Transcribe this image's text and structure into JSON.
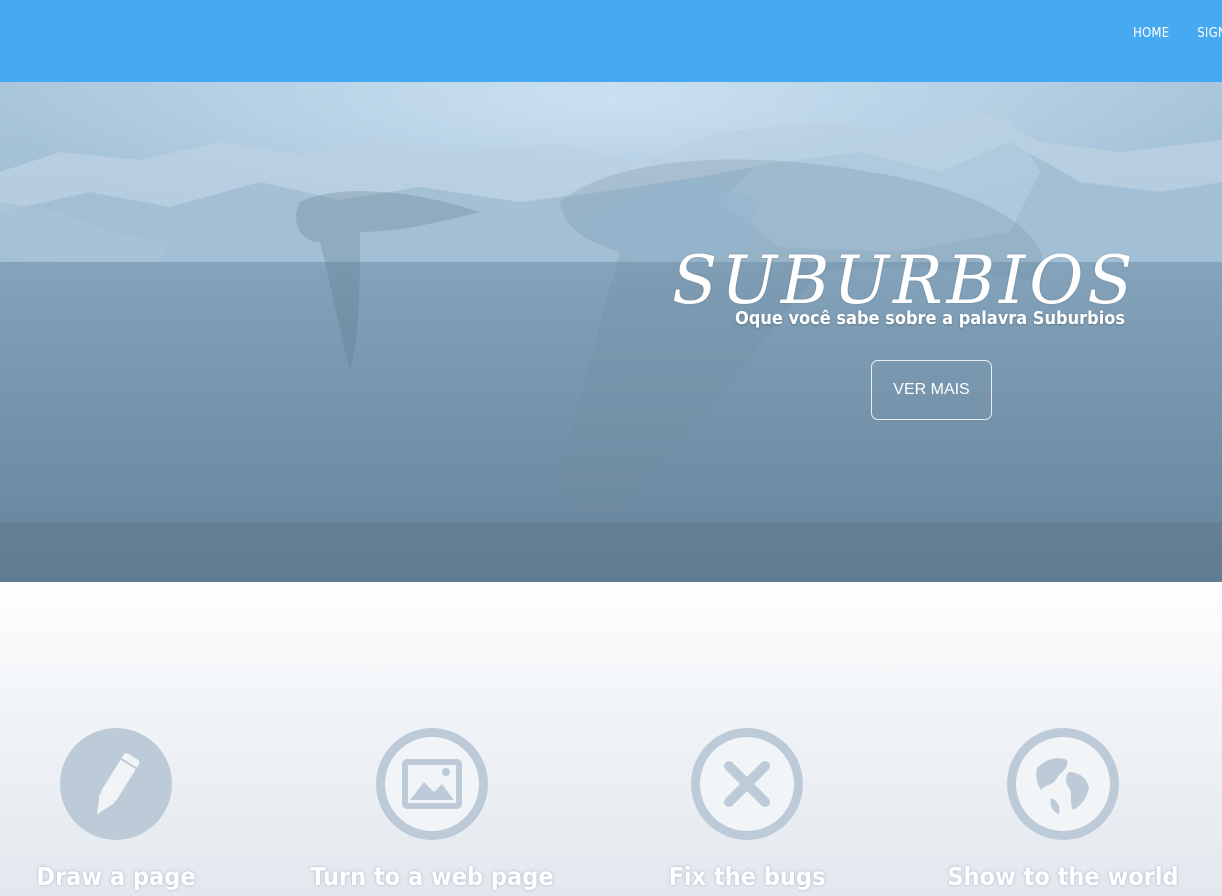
{
  "nav": {
    "items": [
      {
        "label": "HOME"
      },
      {
        "label": "SIGN"
      }
    ]
  },
  "hero": {
    "title": "SUBURBIOS",
    "subtitle": "Oque você sabe sobre a palavra Suburbios",
    "button_label": "VER MAIS"
  },
  "features": [
    {
      "label": "Draw a page",
      "icon": "pencil-icon"
    },
    {
      "label": "Turn to a web page",
      "icon": "image-icon"
    },
    {
      "label": "Fix the bugs",
      "icon": "close-icon"
    },
    {
      "label": "Show to the world",
      "icon": "globe-icon"
    }
  ],
  "colors": {
    "topbar": "#46aaf2",
    "icon_circle": "#bdcbd8",
    "icon_glyph": "#f2f5f8"
  }
}
